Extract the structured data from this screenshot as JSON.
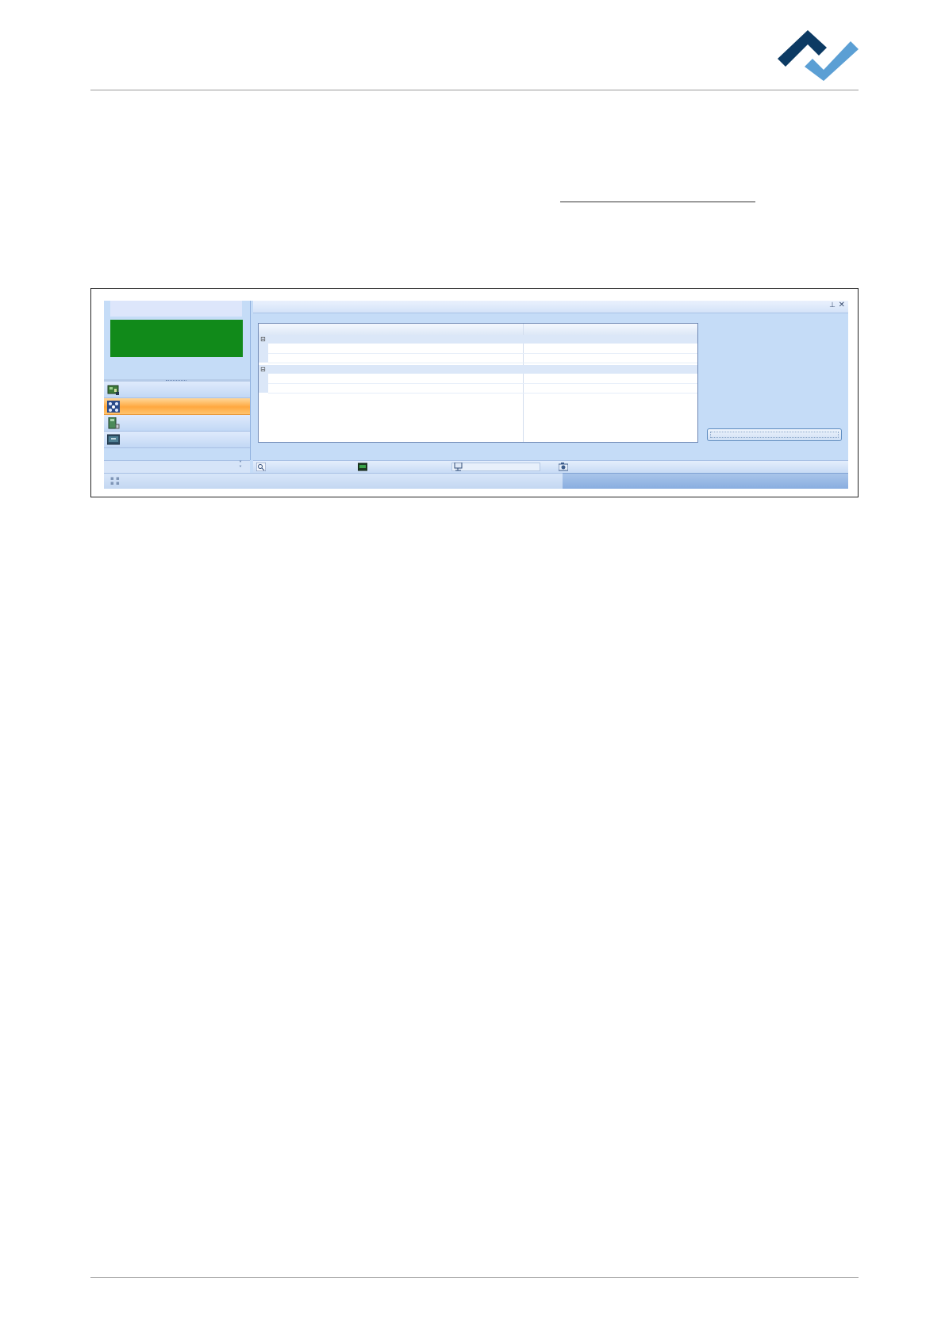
{
  "document": {
    "logo": {
      "icon": "brand-chevron-logo",
      "colors": {
        "dark": "#0c3a63",
        "light": "#5b9fd4"
      }
    }
  },
  "app": {
    "colors": {
      "background": "#c5dcf7",
      "status_green": "#118a1a",
      "active_nav": "#ffa83f"
    },
    "nav_items": [
      {
        "icon": "circuit-board-icon",
        "active": false
      },
      {
        "icon": "network-nodes-icon",
        "active": true
      },
      {
        "icon": "board-component-icon",
        "active": false
      },
      {
        "icon": "monitor-display-icon",
        "active": false
      }
    ],
    "header_icons": [
      "pin-icon",
      "close-icon"
    ],
    "toolbar_icons": [
      "magnifier-icon",
      "image-icon",
      "monitor-icon",
      "camera-icon"
    ],
    "nav_footer_icon": "chevron-double-down-icon",
    "statusbar_icon": "resize-grip-icon"
  }
}
